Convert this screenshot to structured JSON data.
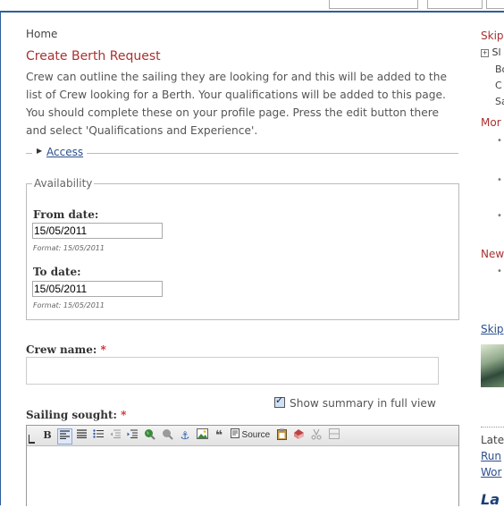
{
  "breadcrumb": "Home",
  "page_title": "Create Berth Request",
  "intro_text": "Crew can outline the sailing they are looking for and this will be added to the list of Crew looking for a Berth. Your qualifications will be added to this page. You should complete these on your profile page. Press the edit button there and select 'Qualifications and Experience'.",
  "access_label": "Access",
  "availability": {
    "legend": "Availability",
    "from_label": "From date:",
    "from_value": "15/05/2011",
    "from_format": "Format: 15/05/2011",
    "to_label": "To date:",
    "to_value": "15/05/2011",
    "to_format": "Format: 15/05/2011"
  },
  "crew_name": {
    "label": "Crew name:",
    "required": "*",
    "value": ""
  },
  "summary_toggle": {
    "label": "Show summary in full view",
    "checked": true
  },
  "sailing_sought": {
    "label": "Sailing sought:",
    "required": "*"
  },
  "toolbar": {
    "bold": "B",
    "source_label": "Source",
    "quote_glyph": "❝"
  },
  "sidebar": {
    "skip1": "Skip",
    "tree_item": "Sl",
    "tree_sub": [
      "Bo",
      "C",
      "Sa"
    ],
    "more": "Mor",
    "news": "New",
    "skip2": "Skip",
    "latest": "Late",
    "link1": "Run",
    "link2": "Wor",
    "bottom": "La"
  }
}
